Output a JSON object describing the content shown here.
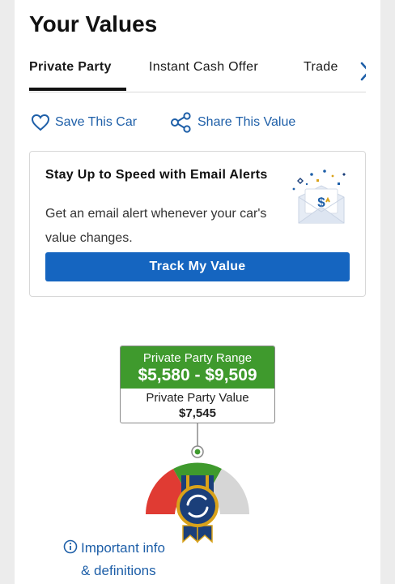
{
  "page": {
    "title": "Your Values"
  },
  "tabs": [
    {
      "label": "Private Party",
      "active": true
    },
    {
      "label": "Instant Cash Offer",
      "active": false
    },
    {
      "label": "Trade",
      "active": false
    }
  ],
  "actions": {
    "save_label": "Save This Car",
    "share_label": "Share This Value"
  },
  "email_alert": {
    "title": "Stay Up to Speed with Email Alerts",
    "description": "Get an email alert whenever your car's value changes.",
    "button_label": "Track My Value"
  },
  "valuation": {
    "range_label": "Private Party Range",
    "range_value": "$5,580 - $9,509",
    "value_label": "Private Party Value",
    "value_amount": "$7,545"
  },
  "info": {
    "line1": "Important info",
    "line2": "& definitions"
  },
  "colors": {
    "accent_blue": "#1565c0",
    "link_blue": "#1e5fa8",
    "range_green": "#3f9a2d",
    "gauge_red": "#e03b33",
    "gauge_gray": "#d6d6d6",
    "badge_navy": "#1b3f7a",
    "badge_gold": "#d9a21a"
  }
}
